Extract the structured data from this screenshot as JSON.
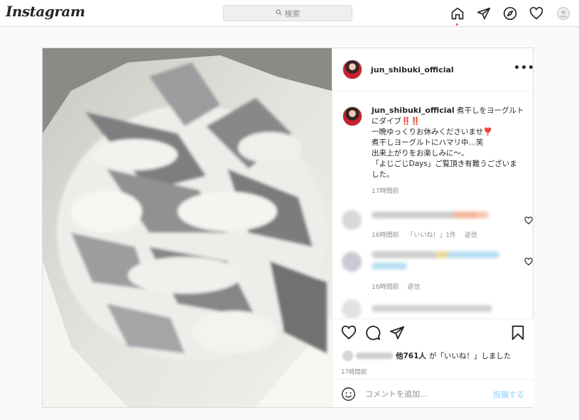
{
  "app": {
    "logo": "Instagram"
  },
  "search": {
    "placeholder": "検索",
    "icon": "search-icon"
  },
  "nav": {
    "icons": [
      "home-icon",
      "direct-icon",
      "explore-icon",
      "activity-icon",
      "profile-icon"
    ]
  },
  "post": {
    "username": "jun_shibuki_official",
    "more_label": "•••",
    "caption": {
      "username": "jun_shibuki_official",
      "lines": [
        "煮干しをヨーグルト",
        "にダイブ‼️‼️",
        "一晩ゆっくりお休みくださいませ❣️",
        "煮干しヨーグルトにハマリ中…笑",
        "出来上がりをお楽しみに〜。",
        "「よじごじDays」ご覧頂き有難うございま",
        "した。"
      ],
      "time": "17時間前"
    },
    "comments": [
      {
        "time": "16時間前",
        "likes": "「いいね！」1件",
        "reply": "返信"
      },
      {
        "time": "16時間前",
        "reply": "返信"
      }
    ],
    "likes": {
      "count": "他761人",
      "suffix": "が「いいね！」しました"
    },
    "time": "17時間前",
    "add_comment": {
      "placeholder": "コメントを追加...",
      "post_label": "投稿する"
    }
  },
  "colors": {
    "accent": "#0095f6",
    "post_disabled": "#b2dffc",
    "notification": "#ed4956"
  }
}
